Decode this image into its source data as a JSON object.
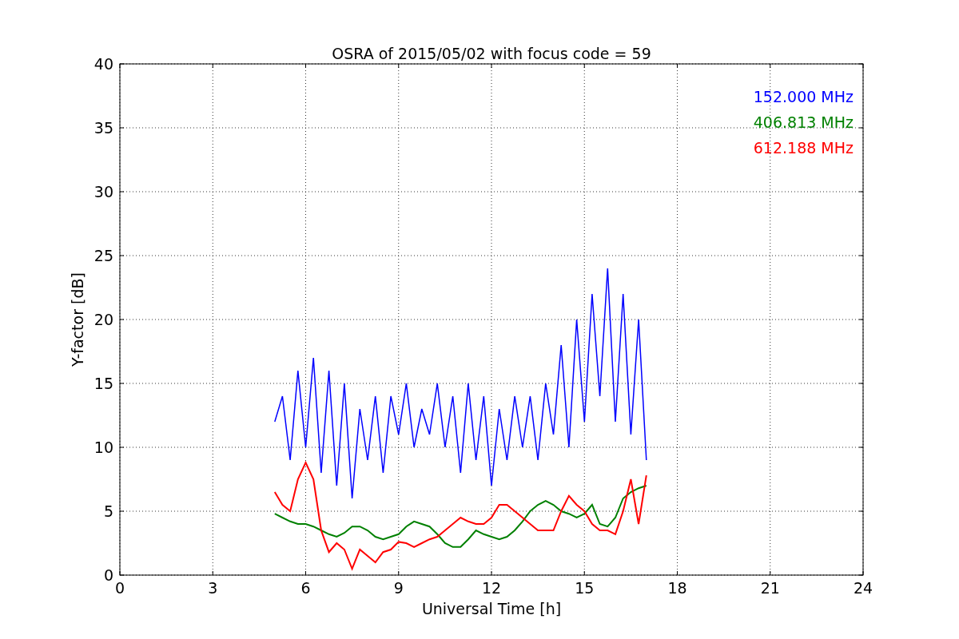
{
  "figure": {
    "chart_data": {
      "type": "line",
      "title": "OSRA of 2015/05/02 with focus code = 59",
      "xlabel": "Universal Time [h]",
      "ylabel": "Y-factor [dB]",
      "x": [
        5.0,
        5.25,
        5.5,
        5.75,
        6.0,
        6.25,
        6.5,
        6.75,
        7.0,
        7.25,
        7.5,
        7.75,
        8.0,
        8.25,
        8.5,
        8.75,
        9.0,
        9.25,
        9.5,
        9.75,
        10.0,
        10.25,
        10.5,
        10.75,
        11.0,
        11.25,
        11.5,
        11.75,
        12.0,
        12.25,
        12.5,
        12.75,
        13.0,
        13.25,
        13.5,
        13.75,
        14.0,
        14.25,
        14.5,
        14.75,
        15.0,
        15.25,
        15.5,
        15.75,
        16.0,
        16.25,
        16.5,
        16.75,
        17.0
      ],
      "series": [
        {
          "name": "152.000 MHz",
          "color": "#0000ff",
          "values": [
            12,
            14,
            9,
            16,
            10,
            17,
            8,
            16,
            7,
            15,
            6,
            13,
            9,
            14,
            8,
            14,
            11,
            15,
            10,
            13,
            11,
            15,
            10,
            14,
            8,
            15,
            9,
            14,
            7,
            13,
            9,
            14,
            10,
            14,
            9,
            15,
            11,
            18,
            10,
            20,
            12,
            22,
            14,
            24,
            12,
            22,
            11,
            20,
            9
          ]
        },
        {
          "name": "406.813 MHz",
          "color": "#008000",
          "values": [
            4.8,
            4.5,
            4.2,
            4.0,
            4.0,
            3.8,
            3.5,
            3.2,
            3.0,
            3.3,
            3.8,
            3.8,
            3.5,
            3.0,
            2.8,
            3.0,
            3.2,
            3.8,
            4.2,
            4.0,
            3.8,
            3.2,
            2.5,
            2.2,
            2.2,
            2.8,
            3.5,
            3.2,
            3.0,
            2.8,
            3.0,
            3.5,
            4.2,
            5.0,
            5.5,
            5.8,
            5.5,
            5.0,
            4.8,
            4.5,
            4.8,
            5.5,
            4.0,
            3.8,
            4.5,
            6.0,
            6.5,
            6.8,
            7.0
          ]
        },
        {
          "name": "612.188 MHz",
          "color": "#ff0000",
          "values": [
            6.5,
            5.5,
            5.0,
            7.5,
            8.8,
            7.5,
            3.5,
            1.8,
            2.5,
            2.0,
            0.5,
            2.0,
            1.5,
            1.0,
            1.8,
            2.0,
            2.6,
            2.5,
            2.2,
            2.5,
            2.8,
            3.0,
            3.5,
            4.0,
            4.5,
            4.2,
            4.0,
            4.0,
            4.5,
            5.5,
            5.5,
            5.0,
            4.5,
            4.0,
            3.5,
            3.5,
            3.5,
            5.0,
            6.2,
            5.5,
            5.0,
            4.0,
            3.5,
            3.5,
            3.2,
            5.0,
            7.5,
            4.0,
            7.8
          ]
        }
      ],
      "grid": true,
      "xlim": [
        0,
        24
      ],
      "ylim": [
        0,
        40
      ],
      "xticks": [
        0,
        3,
        6,
        9,
        12,
        15,
        18,
        21,
        24
      ],
      "yticks": [
        0,
        5,
        10,
        15,
        20,
        25,
        30,
        35,
        40
      ]
    }
  }
}
